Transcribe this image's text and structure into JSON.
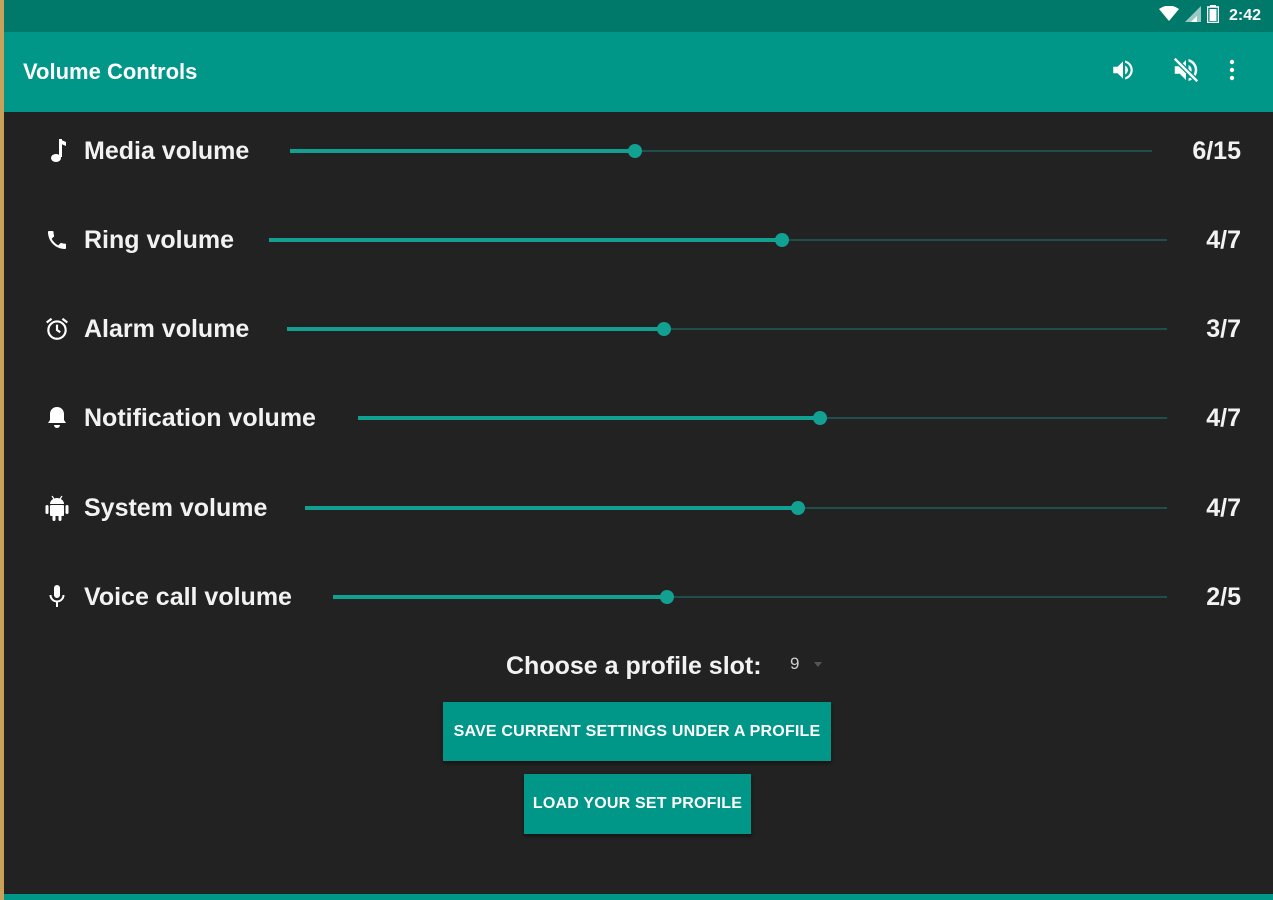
{
  "status_bar": {
    "time": "2:42"
  },
  "app_bar": {
    "title": "Volume Controls",
    "actions": [
      {
        "icon": "volume-up-icon"
      },
      {
        "icon": "volume-mute-icon"
      },
      {
        "icon": "more-vert-icon"
      }
    ]
  },
  "volumes": [
    {
      "label": "Media volume",
      "icon": "music-note-icon",
      "value_text": "6/15",
      "current": 6,
      "max": 15
    },
    {
      "label": "Ring volume",
      "icon": "phone-icon",
      "value_text": "4/7",
      "current": 4,
      "max": 7
    },
    {
      "label": "Alarm volume",
      "icon": "alarm-clock-icon",
      "value_text": "3/7",
      "current": 3,
      "max": 7
    },
    {
      "label": "Notification volume",
      "icon": "bell-icon",
      "value_text": "4/7",
      "current": 4,
      "max": 7
    },
    {
      "label": "System volume",
      "icon": "android-icon",
      "value_text": "4/7",
      "current": 4,
      "max": 7
    },
    {
      "label": "Voice call volume",
      "icon": "microphone-icon",
      "value_text": "2/5",
      "current": 2,
      "max": 5
    }
  ],
  "profile": {
    "label": "Choose a profile slot:",
    "selected_slot": "9",
    "save_button": "SAVE CURRENT SETTINGS UNDER A PROFILE",
    "load_button": "LOAD YOUR SET PROFILE"
  },
  "colors": {
    "accent": "#009688",
    "status_bar": "#00796b",
    "background": "#222222",
    "slider": "#12a092"
  }
}
